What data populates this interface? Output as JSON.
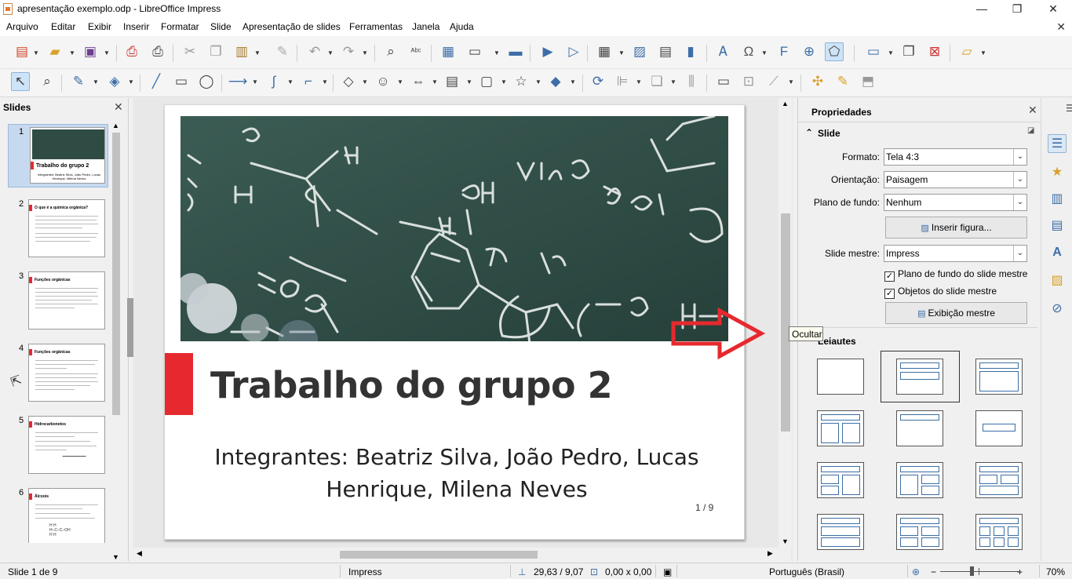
{
  "window": {
    "title": "apresentação exemplo.odp - LibreOffice Impress",
    "minimize": "—",
    "restore": "❐",
    "close": "✕"
  },
  "menubar": {
    "items": [
      "Arquivo",
      "Editar",
      "Exibir",
      "Inserir",
      "Formatar",
      "Slide",
      "Apresentação de slides",
      "Ferramentas",
      "Janela",
      "Ajuda"
    ],
    "close": "✕"
  },
  "slides_pane": {
    "title": "Slides",
    "close": "✕",
    "thumbnails": [
      {
        "num": "1",
        "title": "Trabalho do grupo 2",
        "subtitle": "Integrantes: Beatriz Silva, João Pedro, Lucas Henrique, Milena Neves"
      },
      {
        "num": "2",
        "title": "O que é a química orgânica?"
      },
      {
        "num": "3",
        "title": "Funções orgânicas"
      },
      {
        "num": "4",
        "title": "Funções orgânicas"
      },
      {
        "num": "5",
        "title": "Hidrocarbonetos"
      },
      {
        "num": "6",
        "title": "Álcoois"
      }
    ]
  },
  "slide": {
    "title": "Trabalho do grupo 2",
    "subtitle": "Integrantes: Beatriz Silva, João Pedro, Lucas Henrique, Milena Neves",
    "page_number": "1 / 9",
    "accent_color": "#e6292e"
  },
  "properties": {
    "title": "Propriedades",
    "close": "✕",
    "section_slide": "Slide",
    "format_label": "Formato:",
    "format_value": "Tela 4:3",
    "orientation_label": "Orientação:",
    "orientation_value": "Paisagem",
    "background_label": "Plano de fundo:",
    "background_value": "Nenhum",
    "insert_image_button": "Inserir figura...",
    "master_label": "Slide mestre:",
    "master_value": "Impress",
    "master_bg_check": "Plano de fundo do slide mestre",
    "master_objects_check": "Objetos do slide mestre",
    "master_view_button": "Exibição mestre",
    "section_layouts": "Leiautes"
  },
  "tooltip": "Ocultar",
  "statusbar": {
    "slide_info": "Slide 1 de 9",
    "master_name": "Impress",
    "position": "29,63 / 9,07",
    "size": "0,00 x 0,00",
    "language": "Português (Brasil)",
    "zoom": "70%"
  }
}
